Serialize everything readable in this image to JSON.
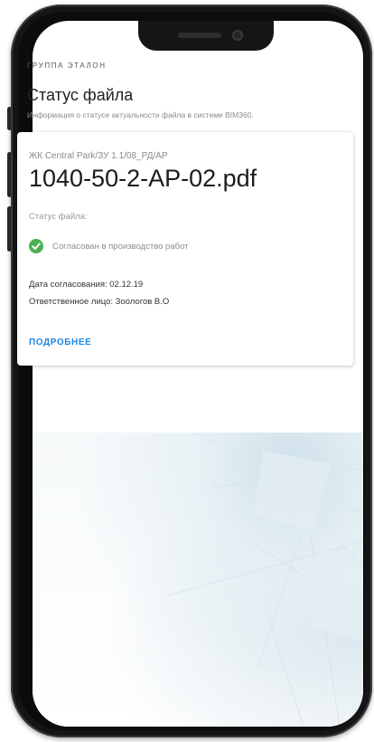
{
  "header": {
    "group_label": "ГРУППА ЭТАЛОН",
    "title": "Статус файла",
    "subtitle": "Информация о статусе актуальности файла в системе BIM360."
  },
  "card": {
    "project_path": "ЖК Central Park/ЗУ 1.1/08_РД/АР",
    "file_name": "1040-50-2-AP-02.pdf",
    "status_label": "Статус файла:",
    "status_text": "Согласован в производство работ",
    "approval_date": "Дата согласования: 02.12.19",
    "responsible": "Ответственное лицо: Зоологов В.О",
    "details_button": "ПОДРОБНЕЕ"
  },
  "icons": {
    "status": "check-circle-icon"
  },
  "colors": {
    "accent": "#1e88e5",
    "status_ok": "#4caf50",
    "phone_frame": "#151515"
  }
}
